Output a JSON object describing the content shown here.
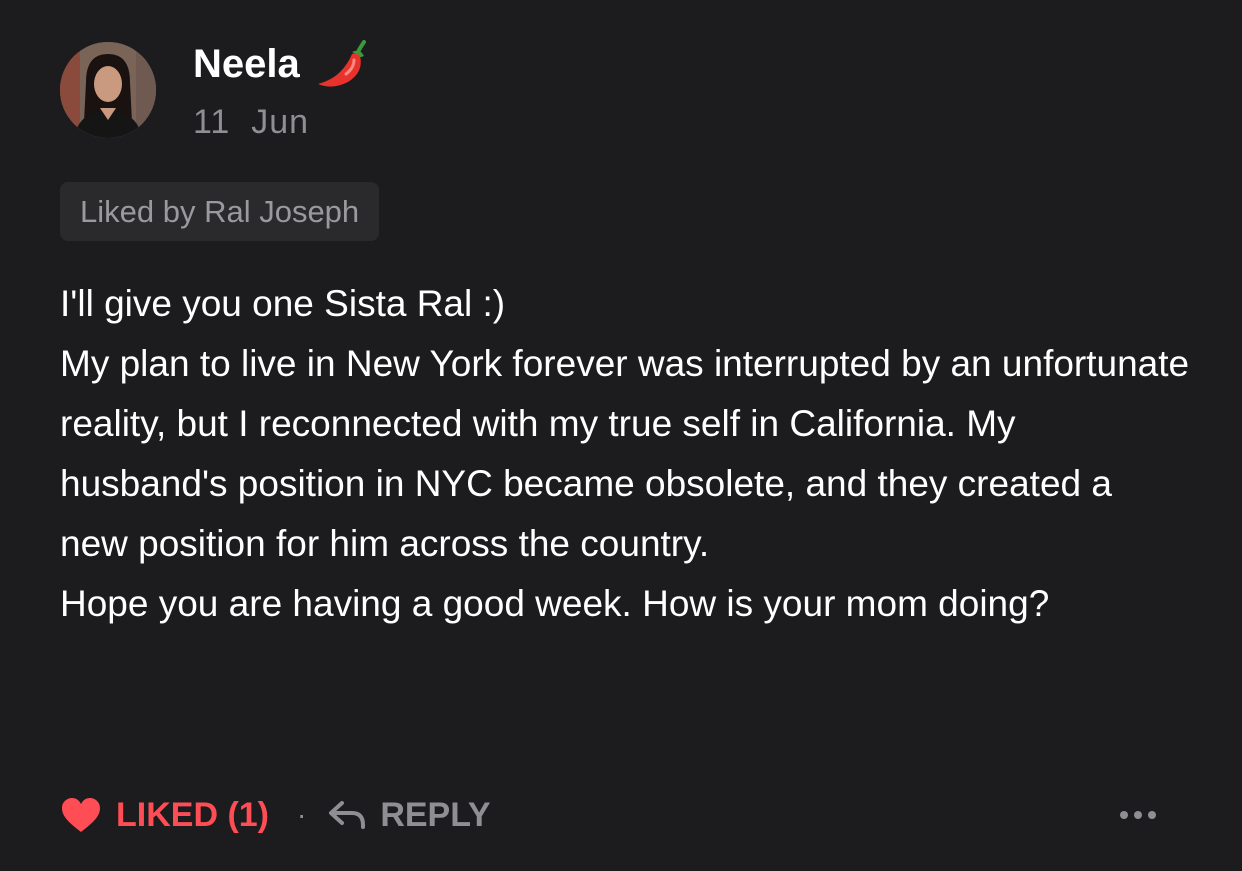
{
  "comment": {
    "author": {
      "name": "Neela",
      "badge_icon": "chili-pepper-icon",
      "avatar_icon": "avatar"
    },
    "timestamp": "11  Jun",
    "liked_by": "Liked by Ral Joseph",
    "body": [
      "I'll give you one Sista Ral :)",
      "My plan to live in New York forever was interrupted by an unfortunate reality, but I reconnected with my true self in California. My husband's position in NYC became obsolete, and they created a new position for him across the country.",
      "Hope you are having a good week. How is your mom doing?"
    ],
    "actions": {
      "like_label": "LIKED (1)",
      "like_icon": "heart-icon",
      "separator": "·",
      "reply_label": "REPLY",
      "reply_icon": "reply-arrow-icon",
      "more_icon": "more-options-icon"
    },
    "colors": {
      "background": "#1c1c1e",
      "liked_accent": "#ff4d55",
      "muted_text": "#8e8e93",
      "badge_background": "#2a2a2c"
    }
  }
}
